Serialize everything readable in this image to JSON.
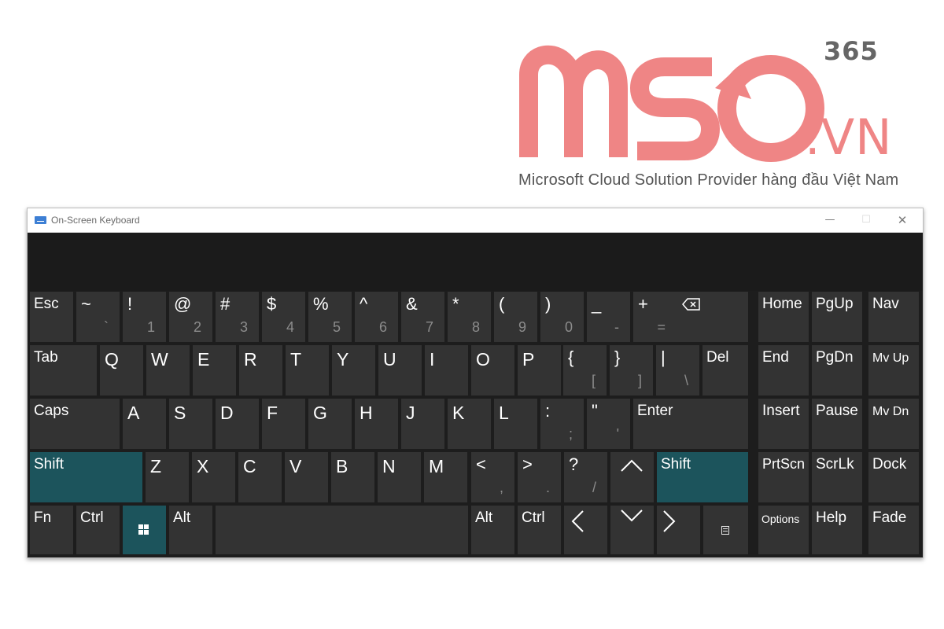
{
  "logo": {
    "brand": "MSO",
    "suffix": ".VN",
    "edition": "365",
    "tagline": "Microsoft Cloud Solution Provider hàng đầu Việt Nam",
    "color": "#ef8585"
  },
  "window": {
    "title": "On-Screen Keyboard",
    "minimize": "—",
    "maximize": "☐",
    "close": "✕"
  },
  "keyboard": {
    "accent_color": "#1c545c",
    "key_color": "#333333",
    "row1": {
      "esc": "Esc",
      "backspace_icon": "backspace-icon"
    },
    "number_keys": [
      {
        "top": "~",
        "bottom": "`"
      },
      {
        "top": "!",
        "bottom": "1"
      },
      {
        "top": "@",
        "bottom": "2"
      },
      {
        "top": "#",
        "bottom": "3"
      },
      {
        "top": "$",
        "bottom": "4"
      },
      {
        "top": "%",
        "bottom": "5"
      },
      {
        "top": "^",
        "bottom": "6"
      },
      {
        "top": "&",
        "bottom": "7"
      },
      {
        "top": "*",
        "bottom": "8"
      },
      {
        "top": "(",
        "bottom": "9"
      },
      {
        "top": ")",
        "bottom": "0"
      },
      {
        "top": "_",
        "bottom": "-"
      },
      {
        "top": "+",
        "bottom": "="
      }
    ],
    "row2": {
      "tab": "Tab",
      "letters": [
        "Q",
        "W",
        "E",
        "R",
        "T",
        "Y",
        "U",
        "I",
        "O",
        "P"
      ],
      "brace_left": {
        "top": "{",
        "bottom": "["
      },
      "brace_right": {
        "top": "}",
        "bottom": "]"
      },
      "pipe": {
        "top": "|",
        "bottom": "\\"
      },
      "del": "Del"
    },
    "row3": {
      "caps": "Caps",
      "letters": [
        "A",
        "S",
        "D",
        "F",
        "G",
        "H",
        "J",
        "K",
        "L"
      ],
      "colon": {
        "top": ":",
        "bottom": ";"
      },
      "quote": {
        "top": "\"",
        "bottom": "'"
      },
      "enter": "Enter"
    },
    "row4": {
      "shift_left": "Shift",
      "letters": [
        "Z",
        "X",
        "C",
        "V",
        "B",
        "N",
        "M"
      ],
      "less": {
        "top": "<",
        "bottom": ","
      },
      "greater": {
        "top": ">",
        "bottom": "."
      },
      "question": {
        "top": "?",
        "bottom": "/"
      },
      "up_icon": "up-arrow-icon",
      "shift_right": "Shift"
    },
    "row5": {
      "fn": "Fn",
      "ctrl_left": "Ctrl",
      "win_icon": "windows-icon",
      "alt_left": "Alt",
      "alt_right": "Alt",
      "ctrl_right": "Ctrl",
      "left_icon": "left-arrow-icon",
      "down_icon": "down-arrow-icon",
      "right_icon": "right-arrow-icon",
      "menu_icon": "context-menu-icon"
    },
    "nav": {
      "home": "Home",
      "pgup": "PgUp",
      "nav": "Nav",
      "end": "End",
      "pgdn": "PgDn",
      "mvup": "Mv Up",
      "insert": "Insert",
      "pause": "Pause",
      "mvdn": "Mv Dn",
      "prtscn": "PrtScn",
      "scrlk": "ScrLk",
      "dock": "Dock",
      "options": "Options",
      "help": "Help",
      "fade": "Fade"
    }
  }
}
